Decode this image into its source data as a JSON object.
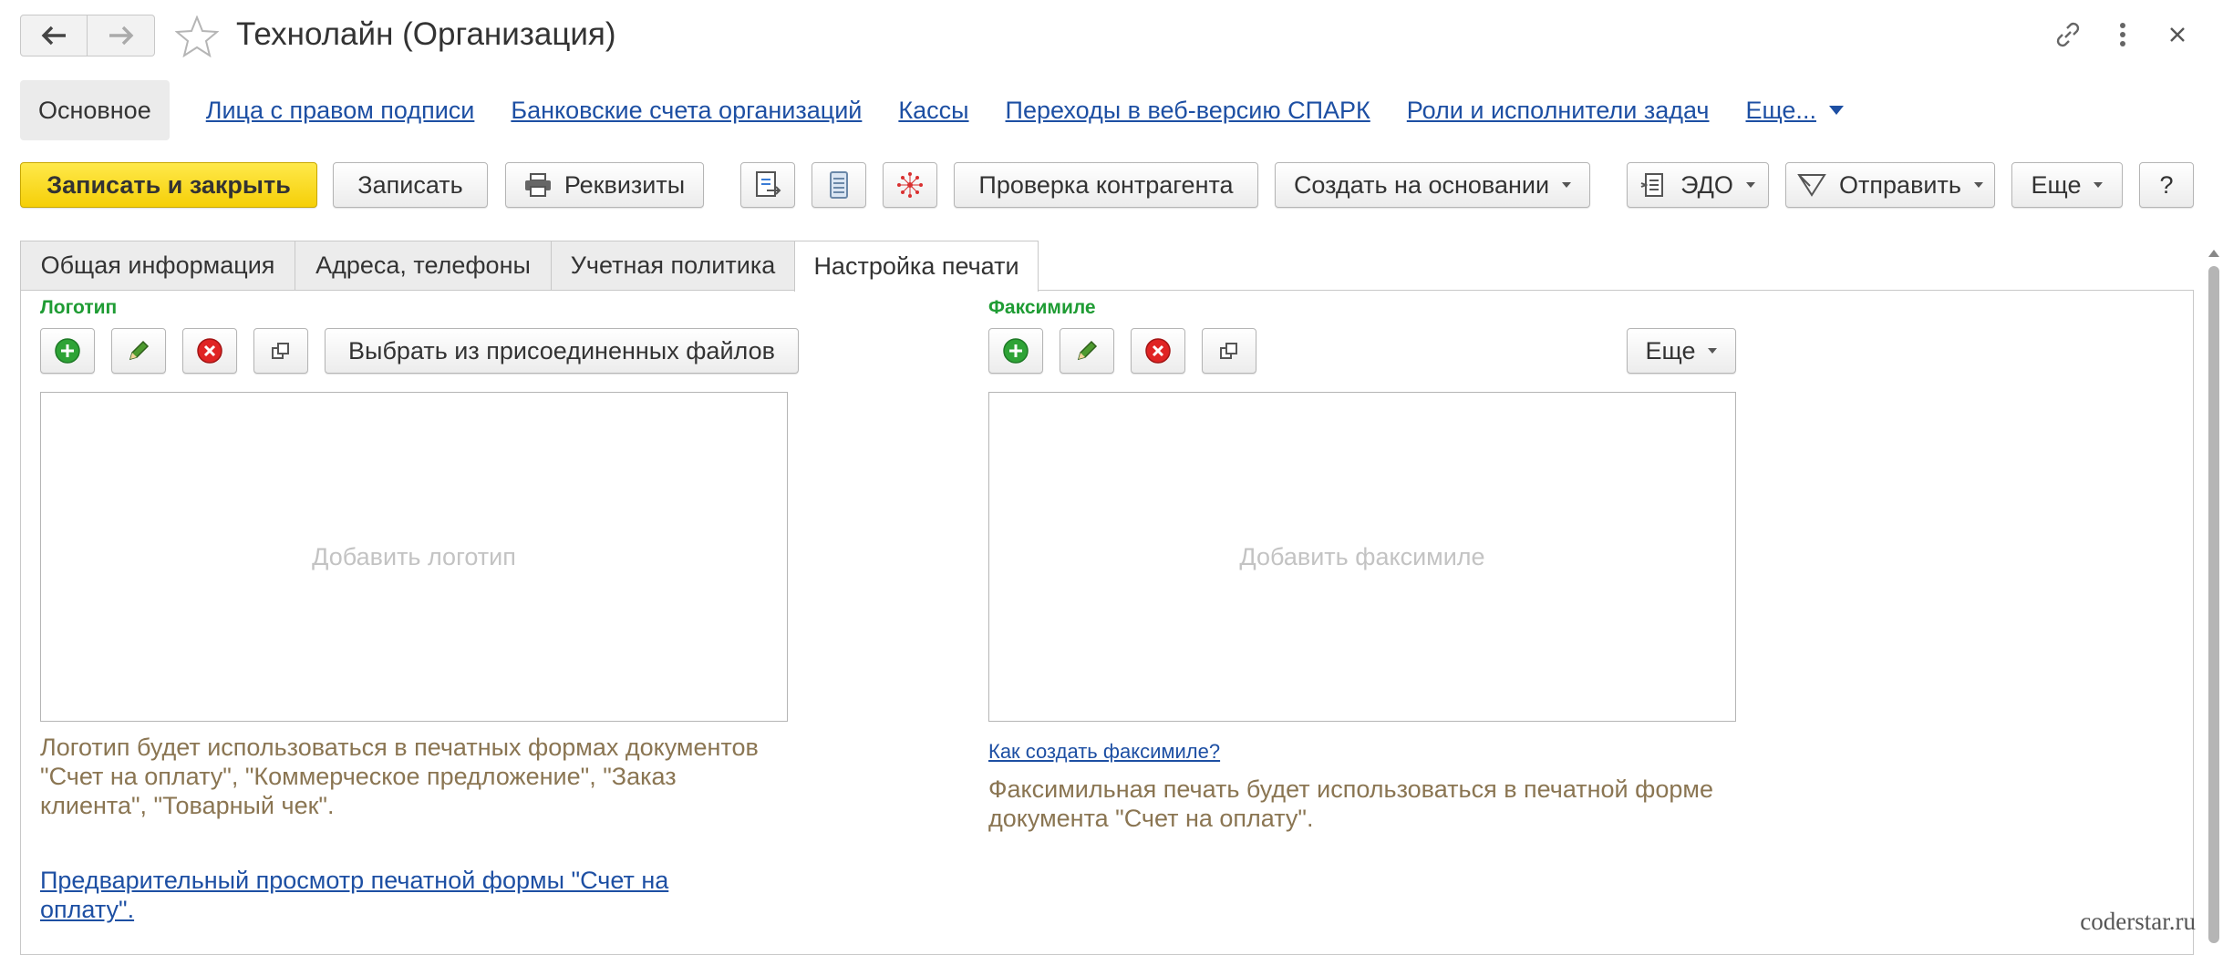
{
  "window": {
    "title": "Технолайн (Организация)"
  },
  "section_nav": {
    "current": "Основное",
    "links": [
      "Лица с правом подписи",
      "Банковские счета организаций",
      "Кассы",
      "Переходы в веб-версию СПАРК",
      "Роли и исполнители задач",
      "Еще..."
    ]
  },
  "toolbar": {
    "save_close": "Записать и закрыть",
    "save": "Записать",
    "requisites": "Реквизиты",
    "check_counterparty": "Проверка контрагента",
    "create_based_on": "Создать на основании",
    "edo": "ЭДО",
    "send": "Отправить",
    "more": "Еще",
    "help": "?"
  },
  "tabs": [
    "Общая информация",
    "Адреса, телефоны",
    "Учетная политика",
    "Настройка печати"
  ],
  "active_tab": "Настройка печати",
  "logo": {
    "title": "Логотип",
    "choose_button": "Выбрать из присоединенных файлов",
    "placeholder": "Добавить логотип",
    "hint_lines": [
      "Логотип будет использоваться в печатных формах документов",
      "\"Счет на оплату\", \"Коммерческое предложение\", \"Заказ",
      "клиента\", \"Товарный чек\"."
    ],
    "preview_link_lines": [
      "Предварительный просмотр печатной формы \"Счет на",
      "оплату\"."
    ]
  },
  "facsimile": {
    "title": "Факсимиле",
    "more_button": "Еще",
    "placeholder": "Добавить факсимиле",
    "howto_link": "Как создать факсимиле?",
    "hint_lines": [
      "Факсимильная печать будет использоваться в печатной форме",
      "документа \"Счет на оплату\"."
    ]
  },
  "watermark": "coderstar.ru",
  "colors": {
    "primary_button": "#f5cf08",
    "link": "#1d4fa3",
    "group_title": "#1f9c34",
    "hint_text": "#8a7552",
    "add_icon": "#2ea336",
    "delete_icon": "#e02424"
  }
}
